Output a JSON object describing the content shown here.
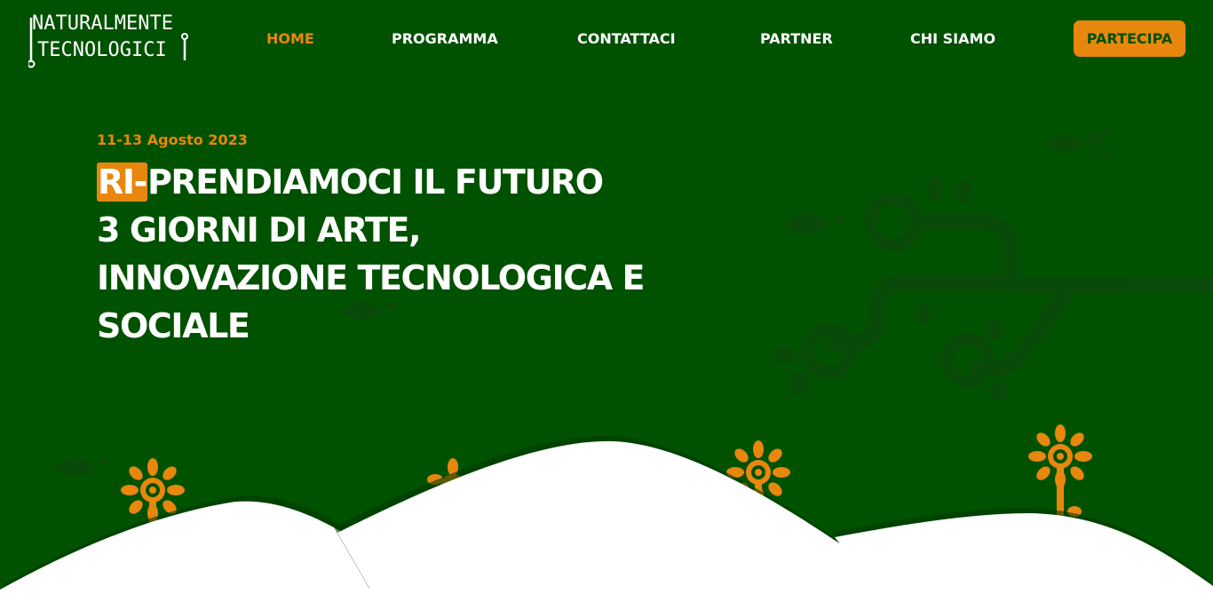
{
  "logo": {
    "line1": "NATURALMENTE",
    "line2": "TECNOLOGICI"
  },
  "nav": {
    "items": [
      {
        "label": "HOME",
        "active": true
      },
      {
        "label": "PROGRAMMA",
        "active": false
      },
      {
        "label": "CONTATTACI",
        "active": false
      },
      {
        "label": "PARTNER",
        "active": false
      },
      {
        "label": "CHI SIAMO",
        "active": false
      }
    ],
    "cta_label": "PARTECIPA"
  },
  "hero": {
    "date": "11-13 Agosto 2023",
    "highlight": "RI-",
    "line1_rest": "PRENDIAMOCI IL FUTURO",
    "line2": "3 GIORNI DI ARTE,",
    "line3": "INNOVAZIONE TECNOLOGICA E",
    "line4": "SOCIALE"
  },
  "colors": {
    "background": "#005100",
    "accent": "#e8870d",
    "text": "#ffffff",
    "hills": "#ffffff"
  }
}
